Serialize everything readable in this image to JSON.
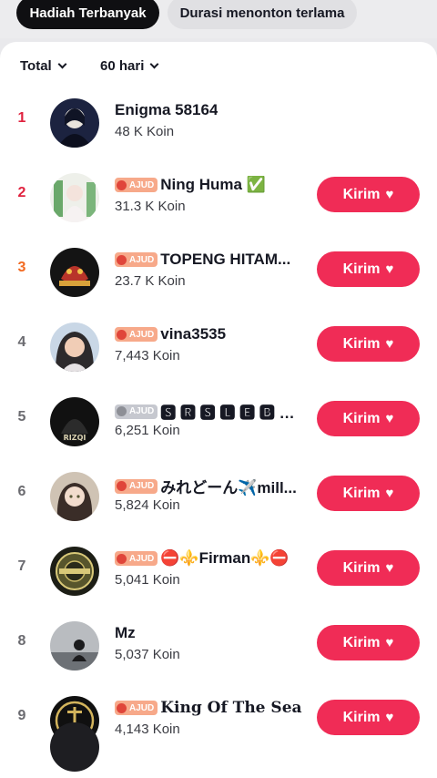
{
  "tabs": [
    {
      "label": "Hadiah Terbanyak",
      "active": true
    },
    {
      "label": "Durasi menonton terlama",
      "active": false
    }
  ],
  "filters": {
    "type": "Total",
    "period": "60 hari"
  },
  "send_label": "Kirim",
  "badge_label": "AJUD",
  "heart_icon": "♥",
  "rows": [
    {
      "rank": "1",
      "name": "Enigma 58164",
      "coins": "48 K Koin",
      "badge": false,
      "button": false
    },
    {
      "rank": "2",
      "name": "Ning Huma ✅",
      "coins": "31.3 K Koin",
      "badge": true,
      "button": true
    },
    {
      "rank": "3",
      "name": "TOPENG HITAM...",
      "coins": "23.7 K Koin",
      "badge": true,
      "button": true
    },
    {
      "rank": "4",
      "name": "vina3535",
      "coins": "7,443 Koin",
      "badge": true,
      "button": true
    },
    {
      "rank": "5",
      "name": "🆂 🆁 🆂 🅻 🅴 🅱 🅴 🆆...",
      "coins": "6,251 Koin",
      "badge": true,
      "button": true
    },
    {
      "rank": "6",
      "name": "みれどーん✈️mill...",
      "coins": "5,824 Koin",
      "badge": true,
      "button": true
    },
    {
      "rank": "7",
      "name": "⛔⚜️Firman⚜️⛔",
      "coins": "5,041 Koin",
      "badge": true,
      "button": true
    },
    {
      "rank": "8",
      "name": "Mz",
      "coins": "5,037 Koin",
      "badge": false,
      "button": true
    },
    {
      "rank": "9",
      "name": "King Of The Sea",
      "coins": "4,143 Koin",
      "badge": true,
      "button": true
    }
  ],
  "colors": {
    "accent": "#f02c56",
    "rank_top": "#e0223f",
    "rank_third": "#f26a21"
  }
}
